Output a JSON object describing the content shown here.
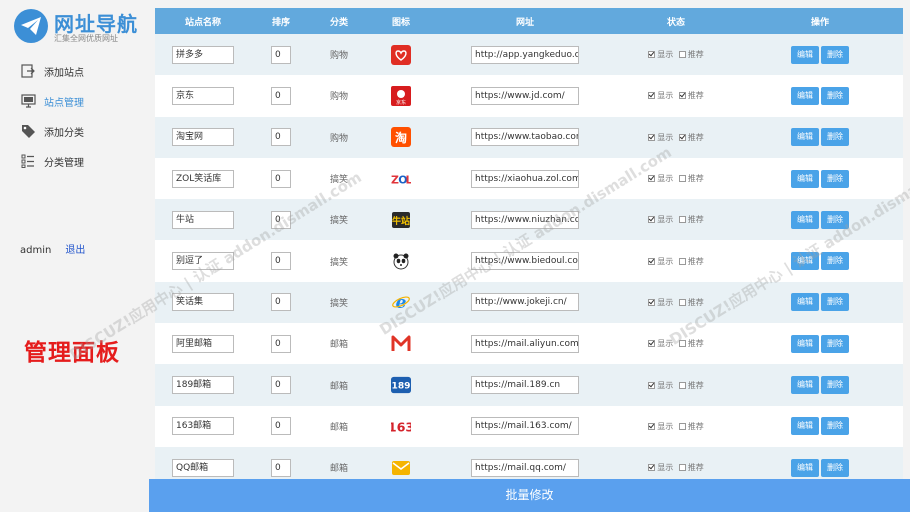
{
  "brand": {
    "title": "网址导航",
    "subtitle": "汇集全网优质网址",
    "color": "#3c8fd6"
  },
  "nav": [
    {
      "label": "添加站点",
      "icon": "add-site-icon",
      "active": false
    },
    {
      "label": "站点管理",
      "icon": "monitor-icon",
      "active": true
    },
    {
      "label": "添加分类",
      "icon": "tag-icon",
      "active": false
    },
    {
      "label": "分类管理",
      "icon": "list-icon",
      "active": false
    }
  ],
  "user": {
    "name": "admin",
    "logout": "退出"
  },
  "panel_label": "管理面板",
  "table": {
    "headers": [
      "站点名称",
      "排序",
      "分类",
      "图标",
      "网址",
      "状态",
      "操作"
    ],
    "status_labels": {
      "show": "显示",
      "recommend": "推荐"
    },
    "actions": {
      "edit": "编辑",
      "delete": "删除"
    },
    "rows": [
      {
        "name": "拼多多",
        "sort": "0",
        "category": "购物",
        "icon": "pinduoduo-icon",
        "url": "http://app.yangkeduo.com",
        "show": true,
        "recommend": false
      },
      {
        "name": "京东",
        "sort": "0",
        "category": "购物",
        "icon": "jd-icon",
        "url": "https://www.jd.com/",
        "show": true,
        "recommend": true
      },
      {
        "name": "淘宝网",
        "sort": "0",
        "category": "购物",
        "icon": "taobao-icon",
        "url": "https://www.taobao.com",
        "show": true,
        "recommend": true
      },
      {
        "name": "ZOL笑话库",
        "sort": "0",
        "category": "搞笑",
        "icon": "zol-icon",
        "url": "https://xiaohua.zol.com",
        "show": true,
        "recommend": false
      },
      {
        "name": "牛站",
        "sort": "0",
        "category": "搞笑",
        "icon": "niuzhan-icon",
        "url": "https://www.niuzhan.com",
        "show": true,
        "recommend": false
      },
      {
        "name": "别逗了",
        "sort": "0",
        "category": "搞笑",
        "icon": "panda-icon",
        "url": "https://www.biedoul.com",
        "show": true,
        "recommend": false
      },
      {
        "name": "笑话集",
        "sort": "0",
        "category": "搞笑",
        "icon": "ie-icon",
        "url": "http://www.jokeji.cn/",
        "show": true,
        "recommend": false
      },
      {
        "name": "阿里邮箱",
        "sort": "0",
        "category": "邮箱",
        "icon": "aliyun-mail-icon",
        "url": "https://mail.aliyun.com",
        "show": true,
        "recommend": false
      },
      {
        "name": "189邮箱",
        "sort": "0",
        "category": "邮箱",
        "icon": "189-icon",
        "url": "https://mail.189.cn",
        "show": true,
        "recommend": false
      },
      {
        "name": "163邮箱",
        "sort": "0",
        "category": "邮箱",
        "icon": "163-icon",
        "url": "https://mail.163.com/",
        "show": true,
        "recommend": false
      },
      {
        "name": "QQ邮箱",
        "sort": "0",
        "category": "邮箱",
        "icon": "qq-mail-icon",
        "url": "https://mail.qq.com/",
        "show": true,
        "recommend": false
      }
    ]
  },
  "batch_button": "批量修改",
  "watermark": "DISCUZ!应用中心 | 认证 addon.dismall.com"
}
